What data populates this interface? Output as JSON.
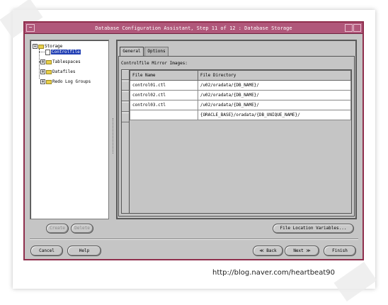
{
  "window": {
    "title": "Database Configuration Assistant, Step 11 of 12 : Database Storage",
    "menu_glyph": "−"
  },
  "tree": {
    "root": {
      "label": "Storage",
      "expander": "⊖"
    },
    "items": [
      {
        "label": "Controlfile",
        "selected": true
      },
      {
        "label": "Tablespaces",
        "expander": "⊕"
      },
      {
        "label": "Datafiles",
        "expander": "⊕"
      },
      {
        "label": "Redo Log Groups",
        "expander": "⊕"
      }
    ]
  },
  "tabs": [
    {
      "label": "General",
      "active": true
    },
    {
      "label": "Options",
      "active": false
    }
  ],
  "general": {
    "section_label": "Controlfile Mirror Images:",
    "columns": [
      "File Name",
      "File Directory"
    ],
    "rows": [
      {
        "name": "control01.ctl",
        "dir": "/u02/oradata/{DB_NAME}/"
      },
      {
        "name": "control02.ctl",
        "dir": "/u02/oradata/{DB_NAME}/"
      },
      {
        "name": "control03.ctl",
        "dir": "/u02/oradata/{DB_NAME}/"
      },
      {
        "name": "",
        "dir": "{ORACLE_BASE}/oradata/{DB_UNIQUE_NAME}/"
      }
    ]
  },
  "buttons": {
    "create": "Create",
    "delete": "Delete",
    "file_location": "File Location Variables...",
    "cancel": "Cancel",
    "help": "Help",
    "back": "Back",
    "back_glyph": "≪",
    "next": "Next",
    "next_glyph": "≫",
    "finish": "Finish"
  },
  "watermark": "http://blog.naver.com/heartbeat90"
}
